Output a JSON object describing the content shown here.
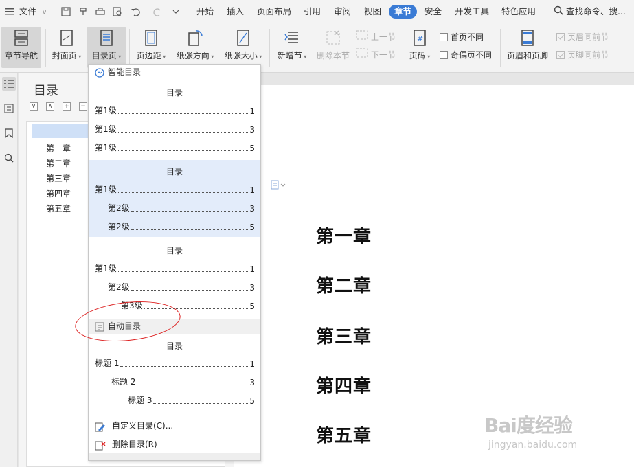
{
  "menu": {
    "file_label": "文件",
    "tabs": [
      "开始",
      "插入",
      "页面布局",
      "引用",
      "审阅",
      "视图",
      "章节",
      "安全",
      "开发工具",
      "特色应用"
    ],
    "active_tab": "章节",
    "search_label": "查找命令、搜..."
  },
  "ribbon": {
    "nav_label": "章节导航",
    "cover_label": "封面页",
    "toc_label": "目录页",
    "margin_label": "页边距",
    "orient_label": "纸张方向",
    "size_label": "纸张大小",
    "new_section_label": "新增节",
    "delete_section_label": "删除本节",
    "prev_section_label": "上一节",
    "next_section_label": "下一节",
    "page_number_label": "页码",
    "first_diff_label": "首页不同",
    "odd_even_label": "奇偶页不同",
    "header_footer_label": "页眉和页脚",
    "header_same_label": "页眉同前节",
    "footer_same_label": "页脚同前节"
  },
  "nav_panel": {
    "title": "目录",
    "items": [
      "第一章",
      "第二章",
      "第三章",
      "第四章",
      "第五章"
    ]
  },
  "dropdown": {
    "smart_label": "智能目录",
    "toc1": {
      "title": "目录",
      "rows": [
        {
          "label": "第1级",
          "page": "1"
        },
        {
          "label": "第1级",
          "page": "3"
        },
        {
          "label": "第1级",
          "page": "5"
        }
      ]
    },
    "toc2": {
      "title": "目录",
      "rows": [
        {
          "label": "第1级",
          "page": "1"
        },
        {
          "label": "第2级",
          "page": "3"
        },
        {
          "label": "第2级",
          "page": "5"
        }
      ]
    },
    "toc3": {
      "title": "目录",
      "rows": [
        {
          "label": "第1级",
          "page": "1"
        },
        {
          "label": "第2级",
          "page": "3"
        },
        {
          "label": "第3级",
          "page": "5"
        }
      ]
    },
    "auto_label": "自动目录",
    "toc4": {
      "title": "目录",
      "rows": [
        {
          "label": "标题 1",
          "page": "1"
        },
        {
          "label": "标题 2",
          "page": "3"
        },
        {
          "label": "标题 3",
          "page": "5"
        }
      ]
    },
    "custom_label": "自定义目录(C)...",
    "delete_label": "删除目录(R)"
  },
  "document": {
    "chapters": [
      "第一章",
      "第二章",
      "第三章",
      "第四章",
      "第五章"
    ]
  },
  "watermark": {
    "main": "Bai度经验",
    "sub": "jingyan.baidu.com"
  },
  "colors": {
    "accent": "#3a7bd5",
    "highlight": "#e3ecfa",
    "annotation": "#dd2222"
  }
}
